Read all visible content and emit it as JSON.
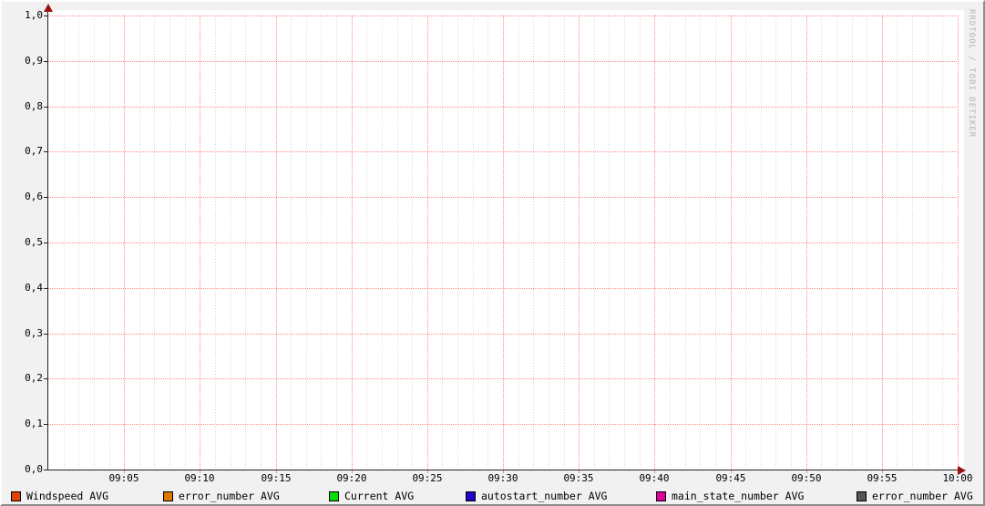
{
  "watermark": "RRDTOOL / TOBI OETIKER",
  "chart_data": {
    "type": "line",
    "title": "",
    "xlabel": "",
    "ylabel": "",
    "x_tick_labels": [
      "09:05",
      "09:10",
      "09:15",
      "09:20",
      "09:25",
      "09:30",
      "09:35",
      "09:40",
      "09:45",
      "09:50",
      "09:55",
      "10:00"
    ],
    "x_major_interval_minutes": 5,
    "x_minor_interval_minutes": 1,
    "x_range_minutes": 60,
    "y_tick_labels": [
      "1,0",
      "0,9",
      "0,8",
      "0,7",
      "0,6",
      "0,5",
      "0,4",
      "0,3",
      "0,2",
      "0,1",
      "0,0"
    ],
    "y_tick_values": [
      1.0,
      0.9,
      0.8,
      0.7,
      0.6,
      0.5,
      0.4,
      0.3,
      0.2,
      0.1,
      0.0
    ],
    "ylim": [
      0.0,
      1.0
    ],
    "grid": true,
    "legend_position": "bottom",
    "series": [
      {
        "label": "Windspeed AVG",
        "color": "#DD4400",
        "values": []
      },
      {
        "label": "error_number AVG",
        "color": "#DD7700",
        "values": []
      },
      {
        "label": "Current AVG",
        "color": "#00DD00",
        "values": []
      },
      {
        "label": "autostart_number AVG",
        "color": "#2200CC",
        "values": []
      },
      {
        "label": "main_state_number AVG",
        "color": "#DD0099",
        "values": []
      },
      {
        "label": "error_number AVG",
        "color": "#555555",
        "values": []
      }
    ],
    "colors": {
      "major_grid": "rgba(255,0,0,0.45)",
      "minor_grid": "rgba(0,0,0,0.16)",
      "axis": "#222222",
      "arrow": "#991111",
      "background": "#F1F1F1",
      "canvas": "#FFFFFF",
      "watermark_text": "#B4B4B4"
    }
  }
}
